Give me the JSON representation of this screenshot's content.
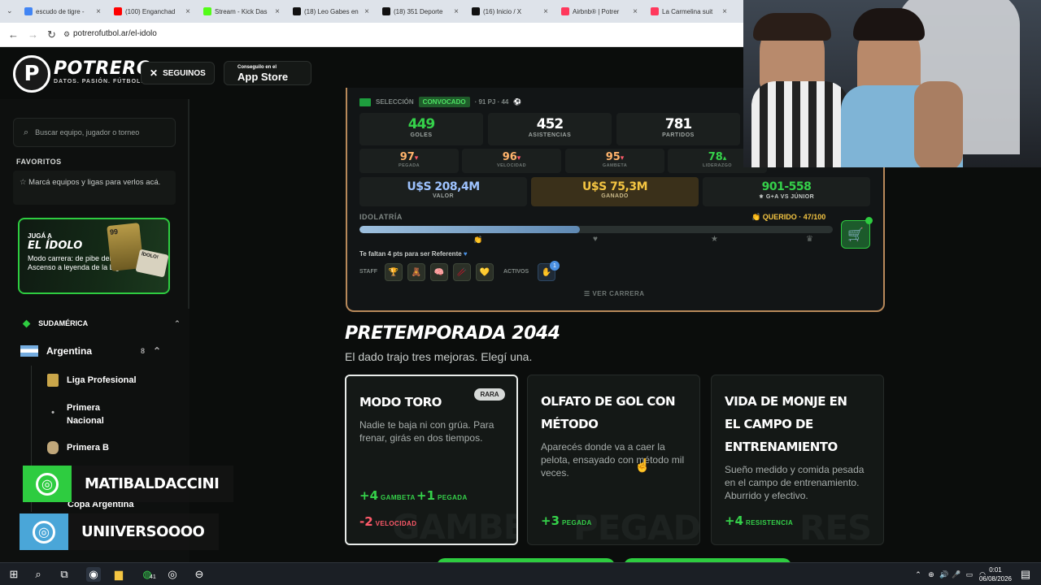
{
  "browser": {
    "tabs": [
      {
        "label": "escudo de tigre -",
        "color": "#4285f4"
      },
      {
        "label": "(100) Enganchad",
        "color": "#ff0000"
      },
      {
        "label": "Stream - Kick Das",
        "color": "#53fc18"
      },
      {
        "label": "(18) Leo Gabes en",
        "color": "#111111"
      },
      {
        "label": "(18) 351 Deporte",
        "color": "#111111"
      },
      {
        "label": "(16) Inicio / X",
        "color": "#111111"
      },
      {
        "label": "Airbnb® | Potrer",
        "color": "#ff385c"
      },
      {
        "label": "La Carmelina suit",
        "color": "#ff385c"
      }
    ],
    "url": "potrerofutbol.ar/el-idolo"
  },
  "header": {
    "logo_letter": "P",
    "logo_text": "POTRERO",
    "tagline": "DATOS. PASIÓN. FÚTBOL.",
    "follow_label": "SEGUINOS",
    "appstore_small": "Conseguilo en el",
    "appstore_big": "App Store"
  },
  "sidebar": {
    "search_placeholder": "Buscar equipo, jugador o torneo",
    "favorites_title": "FAVORITOS",
    "favorites_empty": "Marcá equipos y ligas para verlos acá.",
    "promo": {
      "small": "JUGÁ A",
      "big": "EL ÍDOLO",
      "desc": "Modo carrera: de pibe del Ascenso a leyenda de la Liga",
      "card_rating": "99",
      "card2_text": "ÍDOLO!"
    },
    "region": "SUDAMÉRICA",
    "country": "Argentina",
    "country_count": "8",
    "leagues": [
      "Liga Profesional",
      "Primera Nacional",
      "Primera B",
      "Copa Argentina"
    ]
  },
  "card": {
    "national_label": "SELECCIÓN",
    "national_status": "CONVOCADO",
    "national_stats": "· 91 PJ · 44",
    "stats": [
      {
        "value": "449",
        "label": "GOLES",
        "color": "#35d14a"
      },
      {
        "value": "452",
        "label": "ASISTENCIAS",
        "color": "#ffffff"
      },
      {
        "value": "781",
        "label": "PARTIDOS",
        "color": "#ffffff"
      }
    ],
    "attrs": [
      {
        "value": "97",
        "arrow": "▾",
        "label": "PEGADA",
        "color": "#ffb36b",
        "arrow_color": "#ff5a6a"
      },
      {
        "value": "96",
        "arrow": "▾",
        "label": "VELOCIDAD",
        "color": "#ffb36b",
        "arrow_color": "#ff5a6a"
      },
      {
        "value": "95",
        "arrow": "▾",
        "label": "GAMBETA",
        "color": "#ffb36b",
        "arrow_color": "#ff5a6a"
      },
      {
        "value": "78",
        "arrow": "▴",
        "label": "LIDERAZGO",
        "color": "#35d14a",
        "arrow_color": "#35d14a"
      }
    ],
    "value_label": "VALOR",
    "value_amount": "U$S 208,4M",
    "earned_label": "GANADO",
    "earned_amount": "U$S 75,3M",
    "rival_score": "901-558",
    "rival_label": "G+A VS JÚNIOR",
    "idol_label": "IDOLATRÍA",
    "idol_status": "QUERIDO · 47/100",
    "idol_progress": 0.465,
    "referente_note": "Te faltan 4 pts para ser Referente",
    "staff_label": "STAFF",
    "staff_icons": [
      "🏆",
      "🧸",
      "🧠",
      "🥢",
      "💛"
    ],
    "activos_label": "ACTIVOS",
    "activos_badge": "1",
    "career_link": "VER CARRERA"
  },
  "preseason": {
    "title": "PRETEMPORADA 2044",
    "subtitle": "El dado trajo tres mejoras. Elegí una.",
    "options": [
      {
        "title": "MODO TORO",
        "badge": "RARA",
        "desc": "Nadie te baja ni con grúa. Para frenar, girás en dos tiempos.",
        "effects": [
          {
            "n": "+4",
            "w": "GAMBETA",
            "kind": "green"
          },
          {
            "n": "+1",
            "w": "PEGADA",
            "kind": "green"
          },
          {
            "n": "-2",
            "w": "VELOCIDAD",
            "kind": "red"
          }
        ],
        "bg_word": "GAMBETA"
      },
      {
        "title": "OLFATO DE GOL CON MÉTODO",
        "desc": "Aparecés donde va a caer la pelota, ensayado con método mil veces.",
        "effects": [
          {
            "n": "+3",
            "w": "PEGADA",
            "kind": "green"
          }
        ],
        "bg_word": "PEGADA"
      },
      {
        "title": "VIDA DE MONJE EN EL CAMPO DE ENTRENAMIENTO",
        "desc": "Sueño medido y comida pesada en el campo de entrenamiento. Aburrido y efectivo.",
        "effects": [
          {
            "n": "+4",
            "w": "RESISTENCIA",
            "kind": "green"
          }
        ],
        "bg_word": "RES"
      }
    ]
  },
  "overlay": {
    "social1": "MATIBALDACCINI",
    "social2": "UNIIVERSOOOO"
  },
  "taskbar": {
    "time": "0:01",
    "date": "06/08/2026",
    "badge": "41"
  }
}
